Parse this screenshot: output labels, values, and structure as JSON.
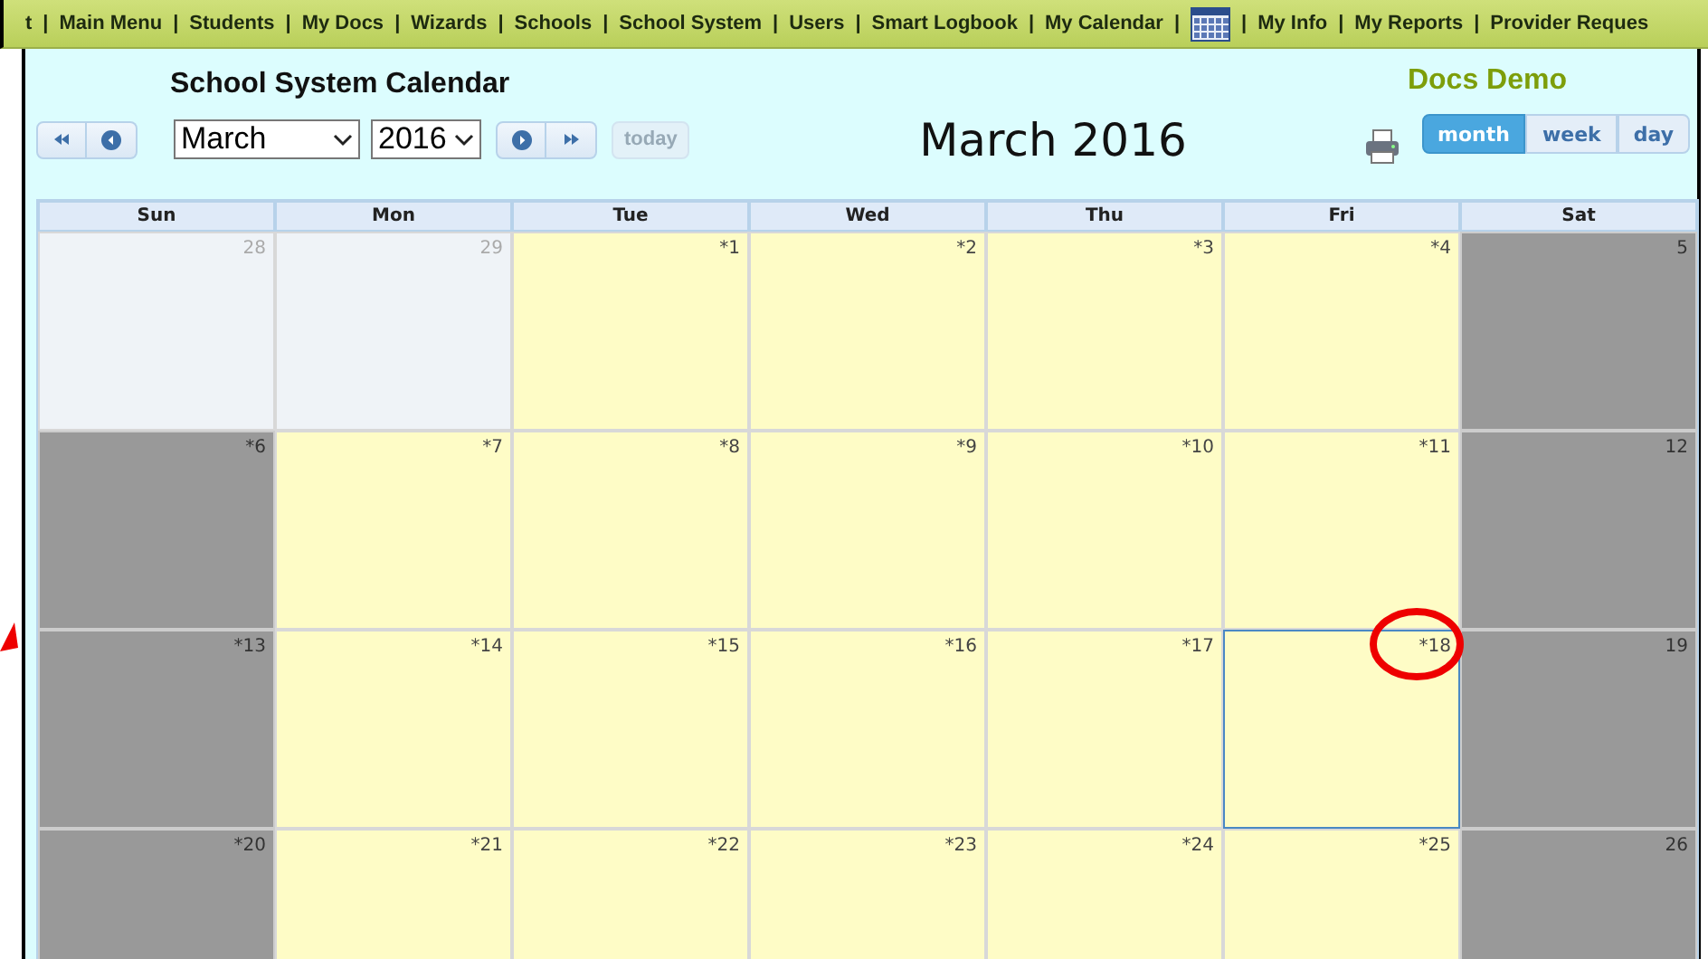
{
  "menu": [
    {
      "label": "t",
      "kind": "text"
    },
    {
      "label": "Main Menu",
      "kind": "text"
    },
    {
      "label": "Students",
      "kind": "text"
    },
    {
      "label": "My Docs",
      "kind": "text"
    },
    {
      "label": "Wizards",
      "kind": "text"
    },
    {
      "label": "Schools",
      "kind": "text"
    },
    {
      "label": "School System",
      "kind": "text"
    },
    {
      "label": "Users",
      "kind": "text"
    },
    {
      "label": "Smart Logbook",
      "kind": "text"
    },
    {
      "label": "My Calendar",
      "kind": "text"
    },
    {
      "kind": "calendar-icon"
    },
    {
      "label": "My Info",
      "kind": "text"
    },
    {
      "label": "My Reports",
      "kind": "text"
    },
    {
      "label": "Provider Reques",
      "kind": "text"
    }
  ],
  "menu_separator": "|",
  "title": "School System Calendar",
  "user": "Docs Demo",
  "month_select": "March",
  "year_select": "2016",
  "today_button": {
    "label": "today",
    "disabled": true
  },
  "heading": "March 2016",
  "views": [
    {
      "label": "month",
      "selected": true
    },
    {
      "label": "week",
      "selected": false
    },
    {
      "label": "day",
      "selected": false
    }
  ],
  "weekdays": [
    "Sun",
    "Mon",
    "Tue",
    "Wed",
    "Thu",
    "Fri",
    "Sat"
  ],
  "days": [
    {
      "label": "28",
      "kind": "other",
      "selected": false
    },
    {
      "label": "29",
      "kind": "other",
      "selected": false
    },
    {
      "label": "*1",
      "kind": "weekday",
      "selected": false
    },
    {
      "label": "*2",
      "kind": "weekday",
      "selected": false
    },
    {
      "label": "*3",
      "kind": "weekday",
      "selected": false
    },
    {
      "label": "*4",
      "kind": "weekday",
      "selected": false
    },
    {
      "label": "5",
      "kind": "weekend",
      "selected": false
    },
    {
      "label": "*6",
      "kind": "weekend",
      "selected": false
    },
    {
      "label": "*7",
      "kind": "weekday",
      "selected": false
    },
    {
      "label": "*8",
      "kind": "weekday",
      "selected": false
    },
    {
      "label": "*9",
      "kind": "weekday",
      "selected": false
    },
    {
      "label": "*10",
      "kind": "weekday",
      "selected": false
    },
    {
      "label": "*11",
      "kind": "weekday",
      "selected": false
    },
    {
      "label": "12",
      "kind": "weekend",
      "selected": false
    },
    {
      "label": "*13",
      "kind": "weekend",
      "selected": false
    },
    {
      "label": "*14",
      "kind": "weekday",
      "selected": false
    },
    {
      "label": "*15",
      "kind": "weekday",
      "selected": false
    },
    {
      "label": "*16",
      "kind": "weekday",
      "selected": false
    },
    {
      "label": "*17",
      "kind": "weekday",
      "selected": false
    },
    {
      "label": "*18",
      "kind": "weekday",
      "selected": true
    },
    {
      "label": "19",
      "kind": "weekend",
      "selected": false
    },
    {
      "label": "*20",
      "kind": "weekend",
      "selected": false
    },
    {
      "label": "*21",
      "kind": "weekday",
      "selected": false
    },
    {
      "label": "*22",
      "kind": "weekday",
      "selected": false
    },
    {
      "label": "*23",
      "kind": "weekday",
      "selected": false
    },
    {
      "label": "*24",
      "kind": "weekday",
      "selected": false
    },
    {
      "label": "*25",
      "kind": "weekday",
      "selected": false
    },
    {
      "label": "26",
      "kind": "weekend",
      "selected": false
    }
  ]
}
